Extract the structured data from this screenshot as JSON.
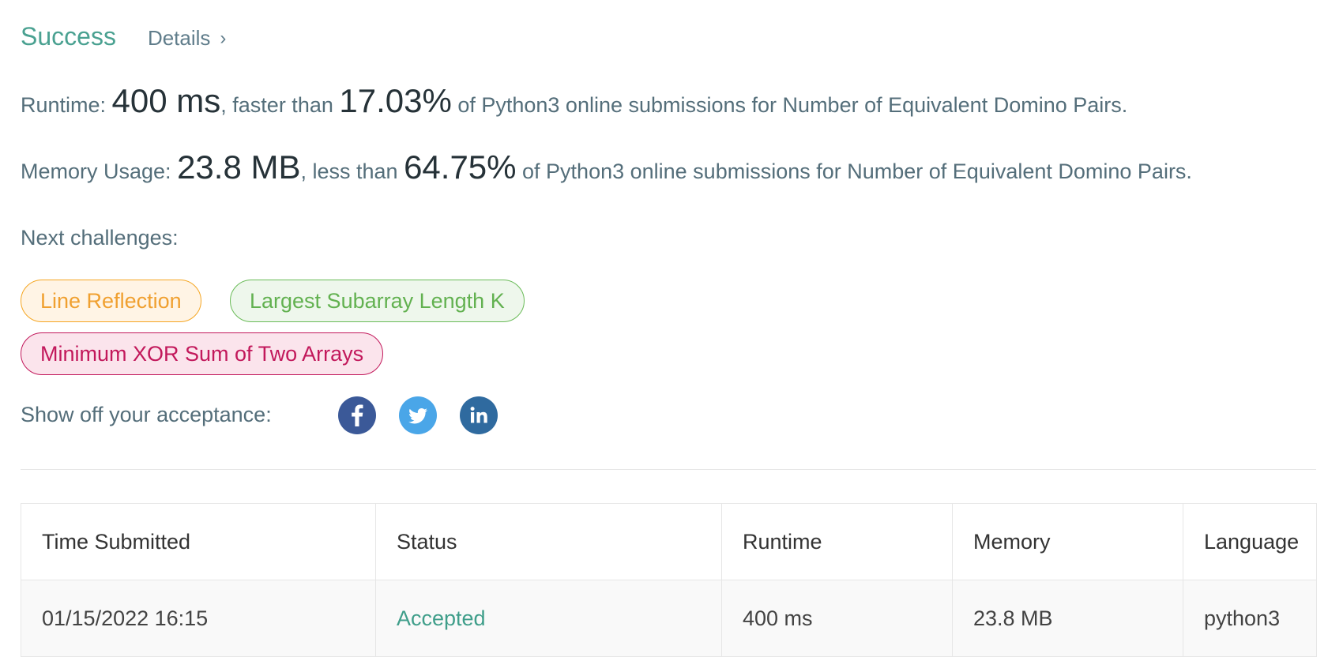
{
  "result": {
    "status_label": "Success",
    "details_label": "Details"
  },
  "runtime_line": {
    "prefix": "Runtime: ",
    "value": "400 ms",
    "middle": ", faster than ",
    "percent": "17.03%",
    "suffix": " of Python3 online submissions for Number of Equivalent Domino Pairs."
  },
  "memory_line": {
    "prefix": "Memory Usage: ",
    "value": "23.8 MB",
    "middle": ", less than ",
    "percent": "64.75%",
    "suffix": " of Python3 online submissions for Number of Equivalent Domino Pairs."
  },
  "next_challenges": {
    "label": "Next challenges:",
    "items": [
      {
        "label": "Line Reflection",
        "color": "#f0a030"
      },
      {
        "label": "Largest Subarray Length K",
        "color": "#62b150"
      },
      {
        "label": "Minimum XOR Sum of Two Arrays",
        "color": "#c2185b"
      }
    ]
  },
  "share": {
    "label": "Show off your acceptance:",
    "icons": [
      "facebook-icon",
      "twitter-icon",
      "linkedin-icon"
    ]
  },
  "table": {
    "headers": [
      "Time Submitted",
      "Status",
      "Runtime",
      "Memory",
      "Language"
    ],
    "rows": [
      [
        "01/15/2022 16:15",
        "Accepted",
        "400 ms",
        "23.8 MB",
        "python3"
      ]
    ]
  },
  "colors": {
    "success": "#4aa191",
    "accepted": "#3f9e8a",
    "facebook": "#3b5998",
    "twitter": "#4aa6e8",
    "linkedin": "#2f6a9f"
  }
}
